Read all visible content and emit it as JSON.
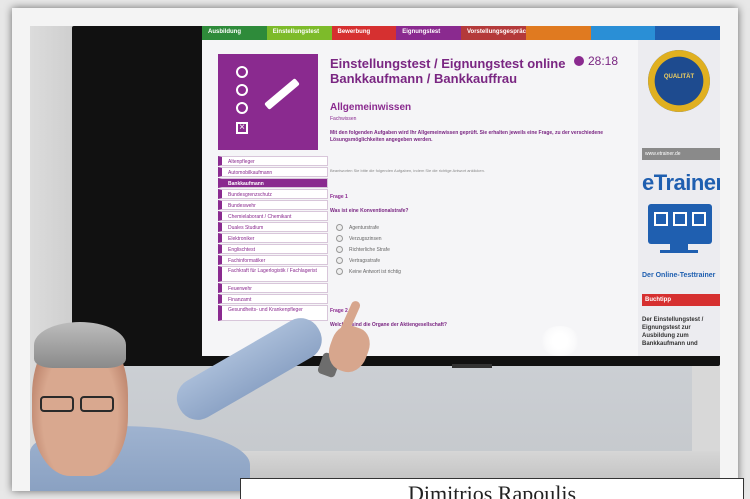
{
  "screen": {
    "tabs": [
      {
        "label": "Ausbildung",
        "color": "#2e8b3a"
      },
      {
        "label": "Einstellungstest",
        "color": "#7dbb2a"
      },
      {
        "label": "Bewerbung",
        "color": "#d63030"
      },
      {
        "label": "Eignungstest",
        "color": "#8a2a8f"
      },
      {
        "label": "Vorstellungsgespräch",
        "color": "#b43a3a"
      },
      {
        "label": "",
        "color": "#e07a20"
      },
      {
        "label": "",
        "color": "#2a8fd6"
      },
      {
        "label": "",
        "color": "#1f5fb0"
      }
    ],
    "title_line1": "Einstellungstest / Eignungstest online",
    "title_line2": "Bankkaufmann / Bankkauffrau",
    "timer": "28:18",
    "section": "Allgemeinwissen",
    "subsection": "Fachwissen",
    "intro": "Mit den folgenden Aufgaben wird Ihr Allgemeinwissen geprüft. Sie erhalten jeweils eine Frage, zu der verschiedene Lösungsmöglichkeiten angegeben werden.",
    "note": "Beantworten Sie bitte die folgenden Aufgaben, indem Sie die richtige Antwort anklicken.",
    "q1_label": "Frage 1",
    "q1_text": "Was ist eine Konventionalstrafe?",
    "q1_options": [
      "Agenturstrafe",
      "Verzugszinsen",
      "Richterliche Strafe",
      "Vertragsstrafe",
      "Keine Antwort ist richtig"
    ],
    "q2_label": "Frage 2",
    "q2_text": "Welches sind die Organe der Aktiengesellschaft?",
    "nav": [
      "Altenpfleger",
      "Automobilkaufmann",
      "Bankkaufmann",
      "Bundesgrenzschutz",
      "Bundeswehr",
      "Chemielaborant / Chemikant",
      "Duales Studium",
      "Elektroniker",
      "Englischtest",
      "Fachinformatiker",
      "Fachkraft für Lagerlogistik / Fachlagerist",
      "Feuerwehr",
      "Finanzamt",
      "Gesundheits- und Krankenpfleger"
    ],
    "nav_active": "Bankkaufmann",
    "seal_text": "QUALITÄT",
    "url": "www.etrainer.de",
    "brand": "eTrainer",
    "tagline": "Der Online-Testtrainer",
    "buchtipp": "Buchtipp",
    "buch_text": "Der Einstellungstest / Eignungstest zur Ausbildung zum Bankkaufmann und"
  },
  "caption": "Dimitrios Rapoulis"
}
